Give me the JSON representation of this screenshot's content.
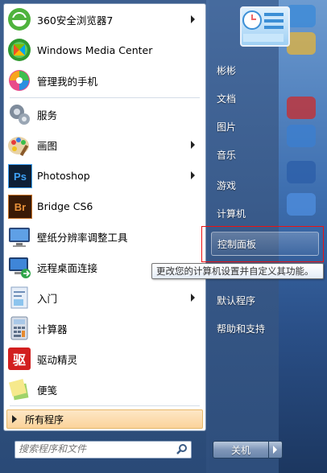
{
  "programs": [
    {
      "label": "360安全浏览器7",
      "icon": "360-browser-icon",
      "has_submenu": true
    },
    {
      "label": "Windows Media Center",
      "icon": "media-center-icon",
      "has_submenu": false
    },
    {
      "label": "管理我的手机",
      "icon": "phone-manager-icon",
      "has_submenu": false
    },
    {
      "label": "服务",
      "icon": "services-icon",
      "has_submenu": false
    },
    {
      "label": "画图",
      "icon": "paint-icon",
      "has_submenu": true
    },
    {
      "label": "Photoshop",
      "icon": "photoshop-icon",
      "has_submenu": true
    },
    {
      "label": "Bridge CS6",
      "icon": "bridge-icon",
      "has_submenu": false
    },
    {
      "label": "壁纸分辨率调整工具",
      "icon": "display-icon",
      "has_submenu": false
    },
    {
      "label": "远程桌面连接",
      "icon": "remote-desktop-icon",
      "has_submenu": false
    },
    {
      "label": "入门",
      "icon": "getting-started-icon",
      "has_submenu": true
    },
    {
      "label": "计算器",
      "icon": "calculator-icon",
      "has_submenu": false
    },
    {
      "label": "驱动精灵",
      "icon": "driver-genius-icon",
      "has_submenu": false
    },
    {
      "label": "便笺",
      "icon": "sticky-notes-icon",
      "has_submenu": false
    }
  ],
  "icon_text": {
    "photoshop": "Ps",
    "bridge": "Br",
    "driver": "驱"
  },
  "all_programs_label": "所有程序",
  "search": {
    "placeholder": "搜索程序和文件"
  },
  "right_items": [
    "彬彬",
    "文档",
    "图片",
    "音乐",
    "游戏",
    "计算机",
    "控制面板",
    "",
    "默认程序",
    "帮助和支持"
  ],
  "active_item": "控制面板",
  "tooltip": "更改您的计算机设置并自定义其功能。",
  "shutdown_label": "关机",
  "colors": {
    "highlight_border": "#e11111",
    "all_programs_bg": "#fbd39a"
  }
}
